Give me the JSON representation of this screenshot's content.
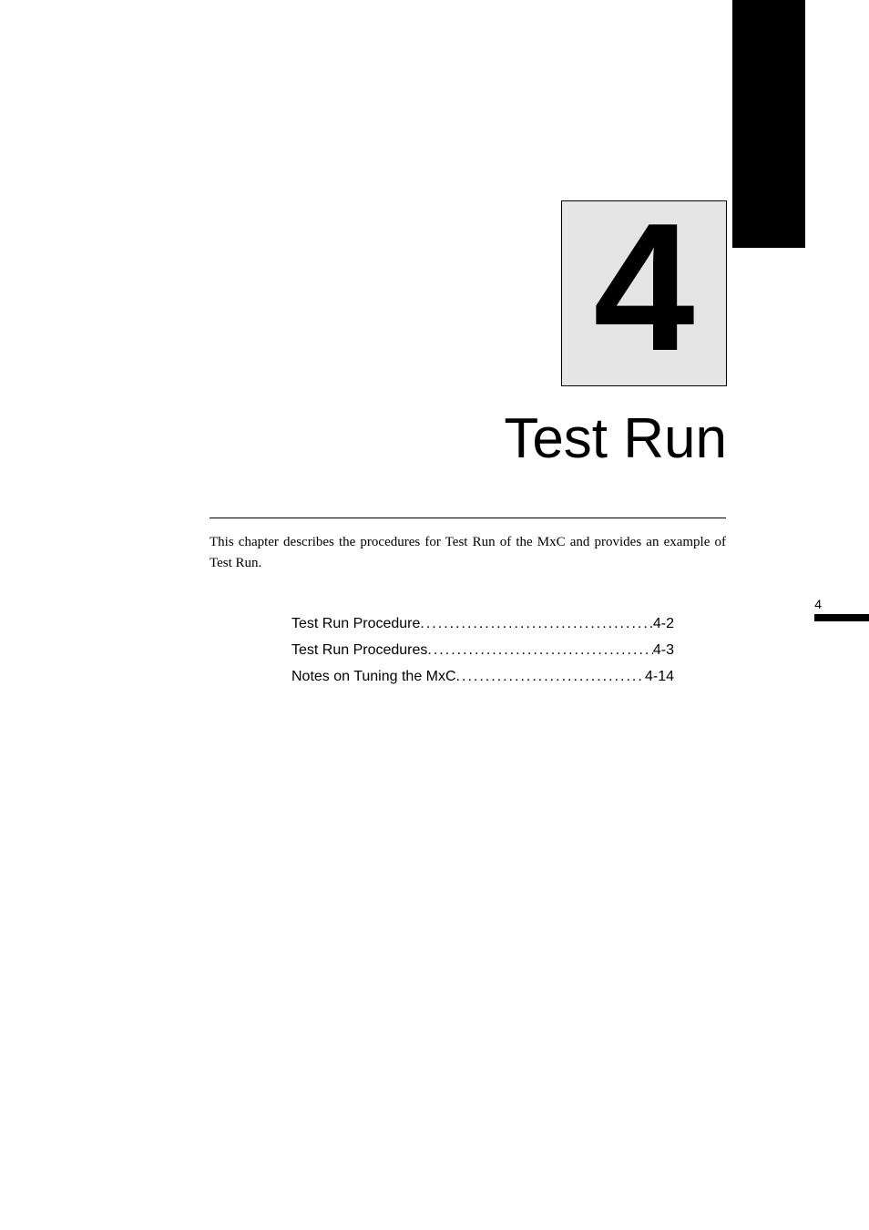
{
  "chapter": {
    "number": "4",
    "title": "Test Run",
    "intro": "This chapter describes the procedures for Test Run of the MxC and provides an example of Test Run.",
    "sideTabNumber": "4"
  },
  "toc": [
    {
      "label": "Test Run Procedure",
      "page": "4-2"
    },
    {
      "label": "Test Run Procedures",
      "page": "4-3"
    },
    {
      "label": "Notes on Tuning the MxC",
      "page": "4-14"
    }
  ]
}
